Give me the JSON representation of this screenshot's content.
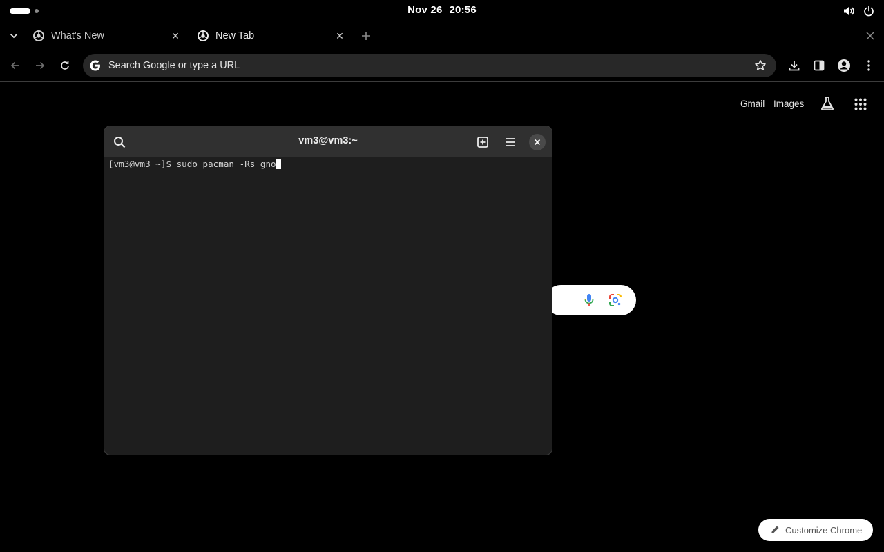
{
  "topbar": {
    "date": "Nov 26",
    "time": "20:56",
    "icons": [
      "volume-icon",
      "power-icon"
    ]
  },
  "tabs": [
    {
      "title": "What's New",
      "active": false,
      "icon": "chrome-icon"
    },
    {
      "title": "New Tab",
      "active": true,
      "icon": "chrome-icon"
    }
  ],
  "toolbar": {
    "omnibox_placeholder": "Search Google or type a URL"
  },
  "ntp": {
    "links": {
      "gmail": "Gmail",
      "images": "Images"
    },
    "customize_label": "Customize Chrome"
  },
  "terminal": {
    "title": "vm3@vm3:~",
    "prompt": "[vm3@vm3 ~]$ ",
    "command": "sudo pacman -Rs gno"
  },
  "colors": {
    "background": "#000000",
    "terminal_bg": "#1e1e1e",
    "terminal_header": "#303030"
  }
}
